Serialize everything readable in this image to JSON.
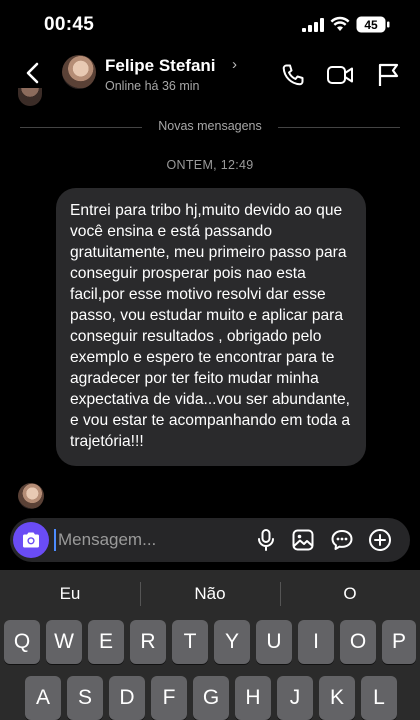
{
  "status_bar": {
    "time": "00:45",
    "battery": "45"
  },
  "header": {
    "contact_name": "Felipe Stefani",
    "presence": "Online há 36 min",
    "icons": [
      "back-chevron-icon",
      "phone-icon",
      "video-camera-icon",
      "flag-icon"
    ]
  },
  "conversation": {
    "new_messages_label": "Novas mensagens",
    "date_label": "ONTEM, 12:49",
    "messages": [
      {
        "from": "contact",
        "text": "Entrei para tribo hj,muito devido ao que você ensina e está passando gratuitamente, meu primeiro passo para conseguir prosperar pois nao esta facil,por esse motivo resolvi dar esse passo, vou estudar muito e aplicar para conseguir resultados , obrigado pelo exemplo e espero te encontrar para te agradecer por ter feito mudar minha expectativa de vida...vou ser abundante, e vou estar te acompanhando em toda a trajetória!!!"
      }
    ]
  },
  "composer": {
    "placeholder": "Mensagem...",
    "icons": [
      "camera-icon",
      "microphone-icon",
      "image-icon",
      "sticker-icon",
      "plus-icon"
    ]
  },
  "keyboard": {
    "suggestions": [
      "Eu",
      "Não",
      "O"
    ],
    "row1": [
      "Q",
      "W",
      "E",
      "R",
      "T",
      "Y",
      "U",
      "I",
      "O",
      "P"
    ],
    "row2": [
      "A",
      "S",
      "D",
      "F",
      "G",
      "H",
      "J",
      "K",
      "L"
    ]
  },
  "colors": {
    "accent": "#6a4cf5",
    "bubble": "#2a2a2c",
    "background": "#000000",
    "key": "#636366"
  }
}
